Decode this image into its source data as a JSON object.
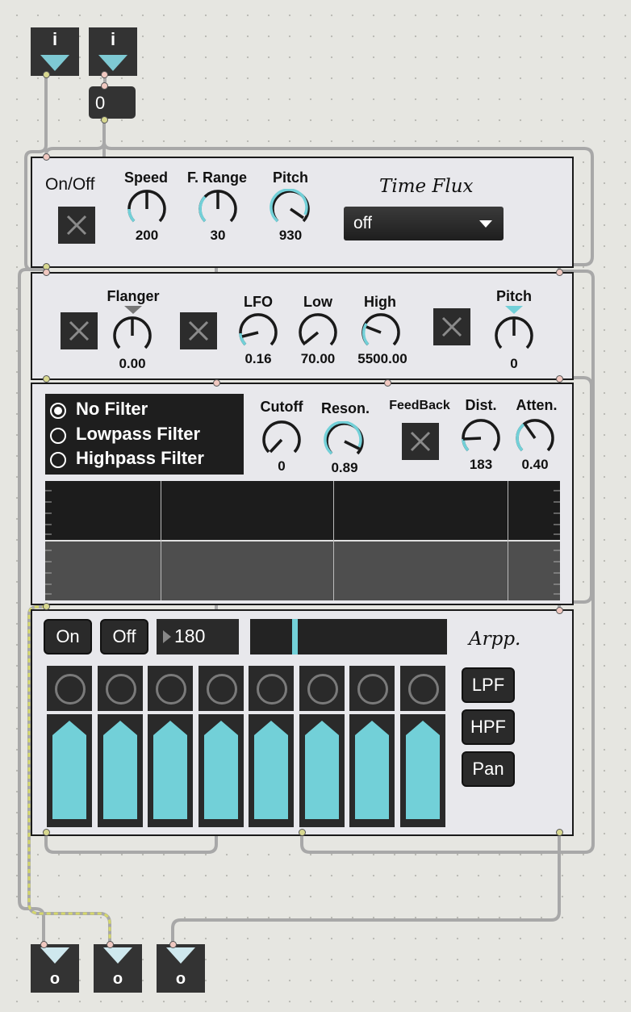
{
  "inputs": {
    "inlet1_label": "i",
    "inlet2_label": "i",
    "number_value": "0"
  },
  "outputs": {
    "outlet1_label": "o",
    "outlet2_label": "o",
    "outlet3_label": "o"
  },
  "panel1": {
    "onoff_label": "On/Off",
    "onoff_state": false,
    "speed": {
      "label": "Speed",
      "value": "200"
    },
    "frange": {
      "label": "F. Range",
      "value": "30"
    },
    "pitch": {
      "label": "Pitch",
      "value": "930"
    },
    "time_flux": {
      "label": "Time Flux",
      "selected": "off"
    }
  },
  "panel2": {
    "flanger": {
      "label": "Flanger",
      "value": "0.00"
    },
    "lfo": {
      "label": "LFO",
      "value": "0.16"
    },
    "low": {
      "label": "Low",
      "value": "70.00"
    },
    "high": {
      "label": "High",
      "value": "5500.00"
    },
    "pitch": {
      "label": "Pitch",
      "value": "0"
    }
  },
  "panel3": {
    "filter_options": [
      "No Filter",
      "Lowpass Filter",
      "Highpass Filter"
    ],
    "filter_selected": "No Filter",
    "cutoff": {
      "label": "Cutoff",
      "value": "0"
    },
    "reson": {
      "label": "Reson.",
      "value": "0.89"
    },
    "feedback": {
      "label": "FeedBack"
    },
    "dist": {
      "label": "Dist.",
      "value": "183"
    },
    "atten": {
      "label": "Atten.",
      "value": "0.40"
    }
  },
  "panel4": {
    "on_label": "On",
    "off_label": "Off",
    "tempo_value": "180",
    "arpp_label": "Arpp.",
    "lpf_label": "LPF",
    "hpf_label": "HPF",
    "pan_label": "Pan",
    "step_count": 8
  },
  "colors": {
    "accent": "#72d0d8",
    "knob_track": "#1a1a1a",
    "panel_bg": "#e8e8ec",
    "dark": "#2a2a2a"
  }
}
